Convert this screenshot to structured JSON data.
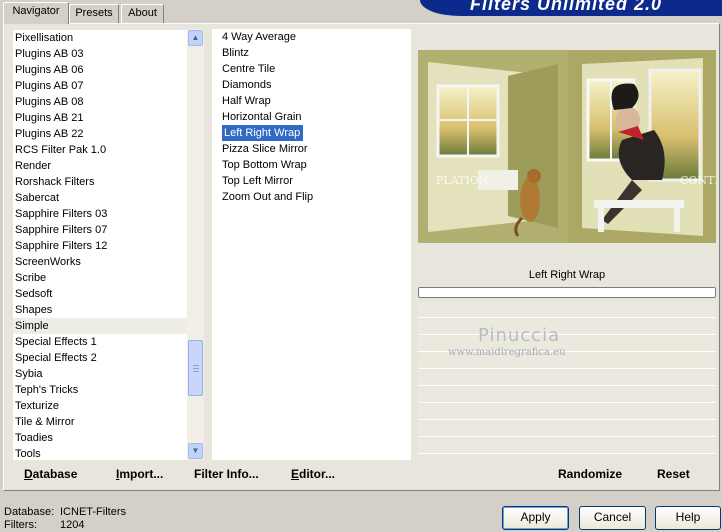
{
  "tabs": [
    {
      "label": "Navigator"
    },
    {
      "label": "Presets"
    },
    {
      "label": "About"
    }
  ],
  "app_title": "Filters Unlimited 2.0",
  "categories": [
    "Pixellisation",
    "Plugins AB 03",
    "Plugins AB 06",
    "Plugins AB 07",
    "Plugins AB 08",
    "Plugins AB 21",
    "Plugins AB 22",
    "RCS Filter Pak 1.0",
    "Render",
    "Rorshack Filters",
    "Sabercat",
    "Sapphire Filters 03",
    "Sapphire Filters 07",
    "Sapphire Filters 12",
    "ScreenWorks",
    "Scribe",
    "Sedsoft",
    "Shapes",
    "Simple",
    "Special Effects 1",
    "Special Effects 2",
    "Sybia",
    "Teph's Tricks",
    "Texturize",
    "Tile & Mirror",
    "Toadies",
    "Tools"
  ],
  "selected_category": "Simple",
  "filters": [
    "4 Way Average",
    "Blintz",
    "Centre Tile",
    "Diamonds",
    "Half Wrap",
    "Horizontal Grain",
    "Left Right Wrap",
    "Pizza Slice Mirror",
    "Top Bottom Wrap",
    "Top Left Mirror",
    "Zoom Out and Flip"
  ],
  "selected_filter": "Left Right Wrap",
  "preview": {
    "left_text": "PLATION",
    "right_text": "CONTEM"
  },
  "filter_name_display": "Left Right Wrap",
  "watermark": {
    "name": "Pinuccia",
    "url": "www.maidiregrafica.eu"
  },
  "toolbar": {
    "database_underline": "D",
    "database_rest": "atabase",
    "import_underline": "I",
    "import_rest": "mport...",
    "filter_info": "Filter Info...",
    "editor_underline": "E",
    "editor_rest": "ditor...",
    "randomize": "Randomize",
    "reset": "Reset"
  },
  "status": {
    "database_label": "Database:",
    "database_value": "ICNET-Filters",
    "filters_label": "Filters:",
    "filters_value": "1204"
  },
  "buttons": {
    "apply": "Apply",
    "cancel": "Cancel",
    "help": "Help"
  },
  "colors": {
    "selection_blue": "#316ac5",
    "banner_blue": "#0b2a8c",
    "panel_bg": "#e8e6dc"
  }
}
